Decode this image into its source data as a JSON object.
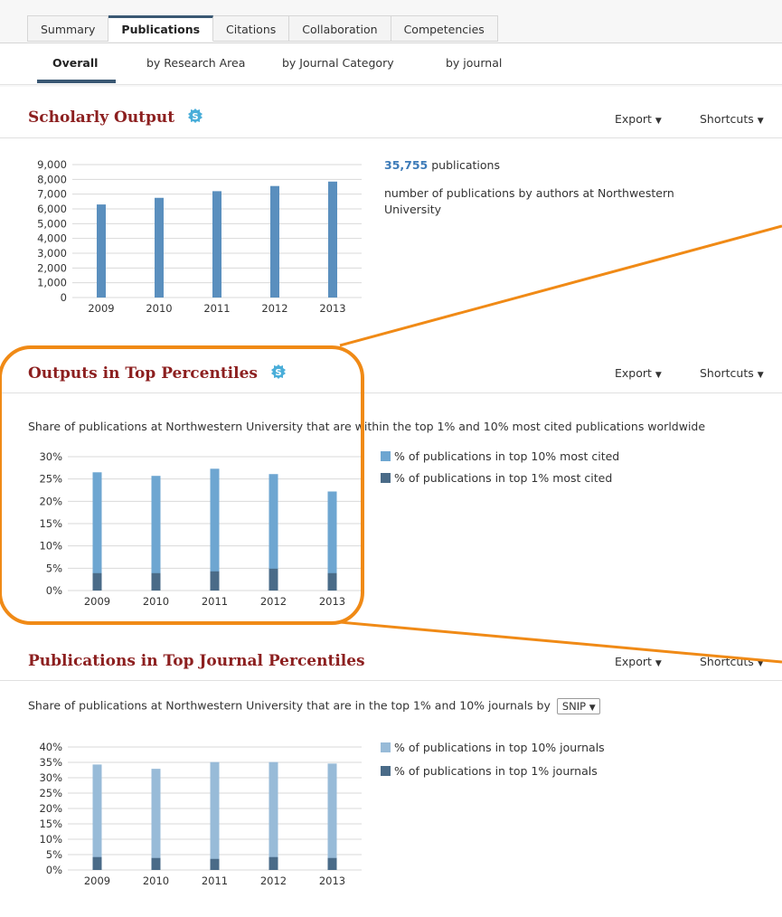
{
  "tabs": [
    "Summary",
    "Publications",
    "Citations",
    "Collaboration",
    "Competencies"
  ],
  "subtabs": [
    "Overall",
    "by Research Area",
    "by Journal Category",
    "by journal"
  ],
  "colors": {
    "accent": "#3a5873",
    "title": "#8c1f1f",
    "bar": "#5a8fbe",
    "top10_cited": "#6ea6d1",
    "top1": "#4a6b88",
    "top10_journals": "#98bbd8",
    "highlight": "#f08a16",
    "link_number": "#3d7bb8"
  },
  "menu": {
    "export": "Export",
    "shortcuts": "Shortcuts"
  },
  "scholarly": {
    "title": "Scholarly Output",
    "icon": "scival-s-icon",
    "count": "35,755",
    "count_unit": "publications",
    "description": "number of publications by authors at Northwestern University"
  },
  "top_percentiles": {
    "title": "Outputs in Top Percentiles",
    "icon": "scival-s-icon",
    "description": "Share of publications at Northwestern University that are within the top 1% and 10% most cited publications worldwide"
  },
  "journal_percentiles": {
    "title": "Publications in Top Journal Percentiles",
    "description": "Share of publications at Northwestern University that are in the top 1% and 10% journals by",
    "metric_select": "SNIP"
  },
  "chart_data": [
    {
      "type": "bar",
      "categories": [
        "2009",
        "2010",
        "2011",
        "2012",
        "2013"
      ],
      "values": [
        6300,
        6750,
        7200,
        7550,
        7850
      ],
      "ylim": [
        0,
        9000
      ],
      "yticks": [
        "0",
        "1,000",
        "2,000",
        "3,000",
        "4,000",
        "5,000",
        "6,000",
        "7,000",
        "8,000",
        "9,000"
      ],
      "grid": true
    },
    {
      "type": "bar",
      "categories": [
        "2009",
        "2010",
        "2011",
        "2012",
        "2013"
      ],
      "series": [
        {
          "name": "% of publications in top 10% most cited",
          "values": [
            26.5,
            25.7,
            27.3,
            26.1,
            22.2
          ]
        },
        {
          "name": "% of publications in top 1% most cited",
          "values": [
            3.9,
            3.9,
            4.3,
            4.9,
            3.9
          ]
        }
      ],
      "ylim": [
        0,
        30
      ],
      "yticks": [
        "0%",
        "5%",
        "10%",
        "15%",
        "20%",
        "25%",
        "30%"
      ],
      "grid": true,
      "legend": "right"
    },
    {
      "type": "bar",
      "categories": [
        "2009",
        "2010",
        "2011",
        "2012",
        "2013"
      ],
      "series": [
        {
          "name": "% of publications in top 10% journals",
          "values": [
            34.3,
            32.9,
            35.1,
            35.1,
            34.6
          ]
        },
        {
          "name": "% of publications in top 1% journals",
          "values": [
            4.2,
            3.9,
            3.6,
            4.2,
            3.9
          ]
        }
      ],
      "ylim": [
        0,
        40
      ],
      "yticks": [
        "0%",
        "5%",
        "10%",
        "15%",
        "20%",
        "25%",
        "30%",
        "35%",
        "40%"
      ],
      "grid": true,
      "legend": "right"
    }
  ]
}
